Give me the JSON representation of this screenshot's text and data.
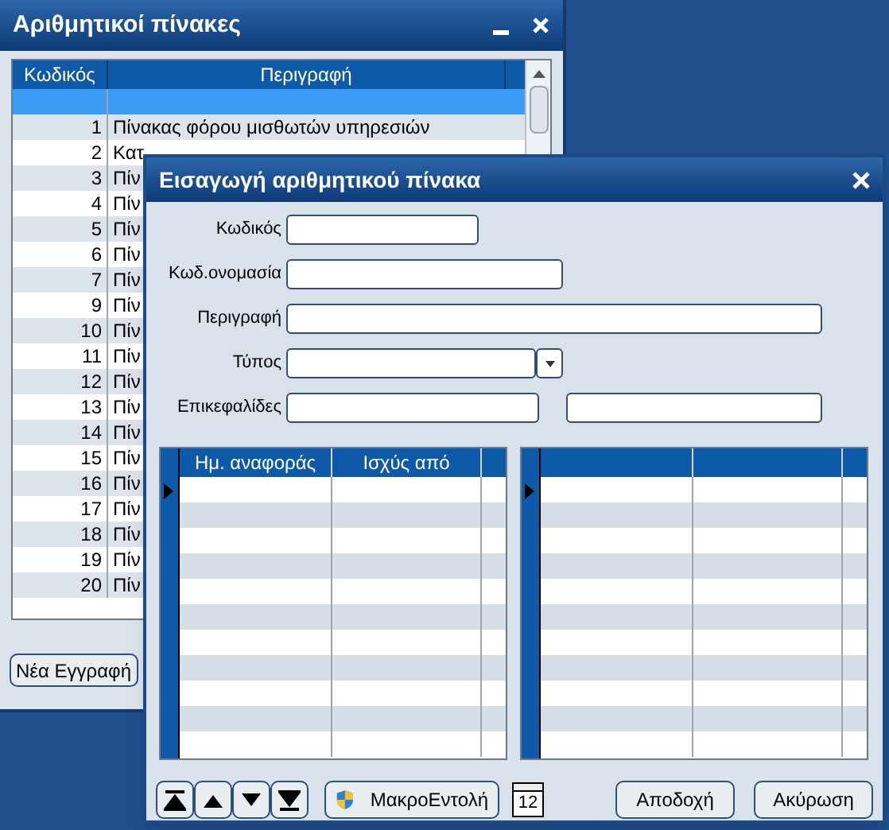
{
  "back_window": {
    "title": "Αριθμητικοί πίνακες",
    "table": {
      "columns": [
        "Κωδικός",
        "Περιγραφή"
      ],
      "rows": [
        {
          "code": "",
          "description": "",
          "selected": true
        },
        {
          "code": "1",
          "description": "Πίνακας φόρου μισθωτών υπηρεσιών",
          "selected": false
        },
        {
          "code": "2",
          "description": "Κατ",
          "selected": false
        },
        {
          "code": "3",
          "description": "Πίν",
          "selected": false
        },
        {
          "code": "4",
          "description": "Πίν",
          "selected": false
        },
        {
          "code": "5",
          "description": "Πίν",
          "selected": false
        },
        {
          "code": "6",
          "description": "Πίν",
          "selected": false
        },
        {
          "code": "7",
          "description": "Πίν",
          "selected": false
        },
        {
          "code": "9",
          "description": "Πίν",
          "selected": false
        },
        {
          "code": "10",
          "description": "Πίν",
          "selected": false
        },
        {
          "code": "11",
          "description": "Πίν",
          "selected": false
        },
        {
          "code": "12",
          "description": "Πίν",
          "selected": false
        },
        {
          "code": "13",
          "description": "Πίν",
          "selected": false
        },
        {
          "code": "14",
          "description": "Πίν",
          "selected": false
        },
        {
          "code": "15",
          "description": "Πίν",
          "selected": false
        },
        {
          "code": "16",
          "description": "Πίν",
          "selected": false
        },
        {
          "code": "17",
          "description": "Πίν",
          "selected": false
        },
        {
          "code": "18",
          "description": "Πίν",
          "selected": false
        },
        {
          "code": "19",
          "description": "Πίν",
          "selected": false
        },
        {
          "code": "20",
          "description": "Πίν",
          "selected": false
        }
      ]
    },
    "buttons": [
      "Νέα Εγγραφή"
    ]
  },
  "dialog": {
    "title": "Εισαγωγή αριθμητικού πίνακα",
    "fields": [
      {
        "label": "Κωδικός",
        "kind": "short"
      },
      {
        "label": "Κωδ.ονομασία",
        "kind": "medium"
      },
      {
        "label": "Περιγραφή",
        "kind": "long"
      },
      {
        "label": "Τύπος",
        "kind": "dropdown"
      },
      {
        "label": "Επικεφαλίδες",
        "kind": "pair"
      }
    ],
    "grids": [
      {
        "kind": "titled",
        "columns": [
          "Ημ. αναφοράς",
          "Ισχύς από"
        ]
      },
      {
        "kind": "untitled"
      }
    ],
    "macro_button": "ΜακροΕντολή",
    "calendar_day": "12",
    "buttons": [
      "Αποδοχή",
      "Ακύρωση"
    ]
  }
}
